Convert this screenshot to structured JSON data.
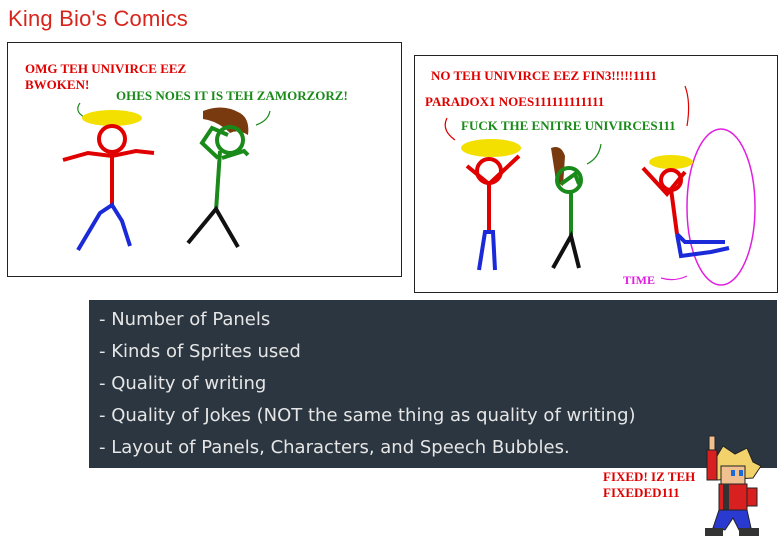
{
  "title": "King Bio's Comics",
  "panel1": {
    "speech_red": [
      "OMG TEH UNIVIRCE EEZ",
      "BWOKEN!"
    ],
    "speech_green": "OHES NOES IT IS TEH ZAMORZORZ!"
  },
  "panel2": {
    "speech_top": "NO TEH UNIVIRCE EEZ FIN3!!!!!1111",
    "speech_paradox": "PARADOX1 NOES111111111111",
    "speech_green": "FUCK THE ENITRE UNIVIRCES111",
    "time_label": "TIME"
  },
  "criteria": [
    "- Number of Panels",
    "- Kinds of Sprites used",
    "- Quality of writing",
    "- Quality of Jokes (NOT the same thing as quality of writing)",
    "- Layout of Panels, Characters, and Speech Bubbles."
  ],
  "sprite_caption": [
    "FIXED! IZ TEH",
    "FIXEDED111"
  ],
  "colors": {
    "title": "#d8251c",
    "box": "#2b3640",
    "red": "#e00000",
    "green": "#1a8a1a",
    "blue": "#1a2ad8",
    "yellow": "#f4e000"
  }
}
